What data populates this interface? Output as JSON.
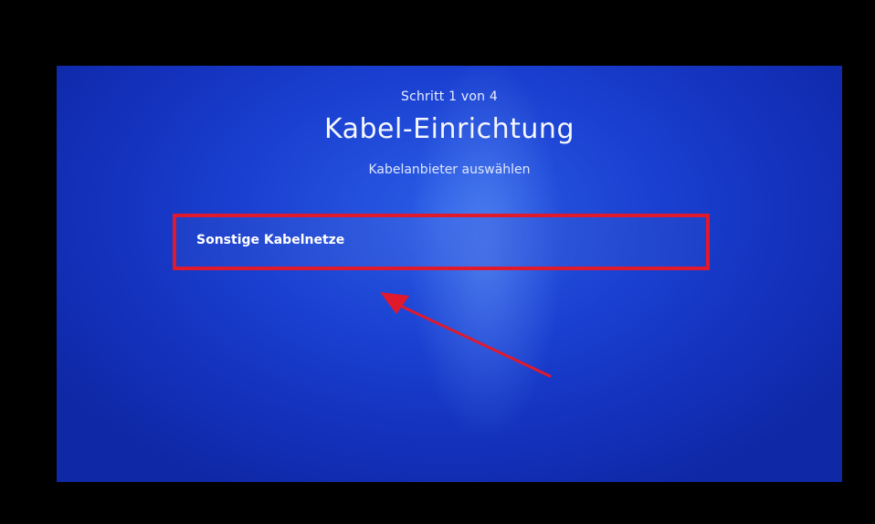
{
  "wizard": {
    "step": "Schritt 1 von 4",
    "title": "Kabel-Einrichtung",
    "subtitle": "Kabelanbieter auswählen"
  },
  "options": [
    {
      "label": "Sonstige Kabelnetze",
      "selected": true
    }
  ],
  "colors": {
    "background_blue": "#1a3fd0",
    "highlight_red": "#e1192c",
    "text": "#ffffff"
  }
}
